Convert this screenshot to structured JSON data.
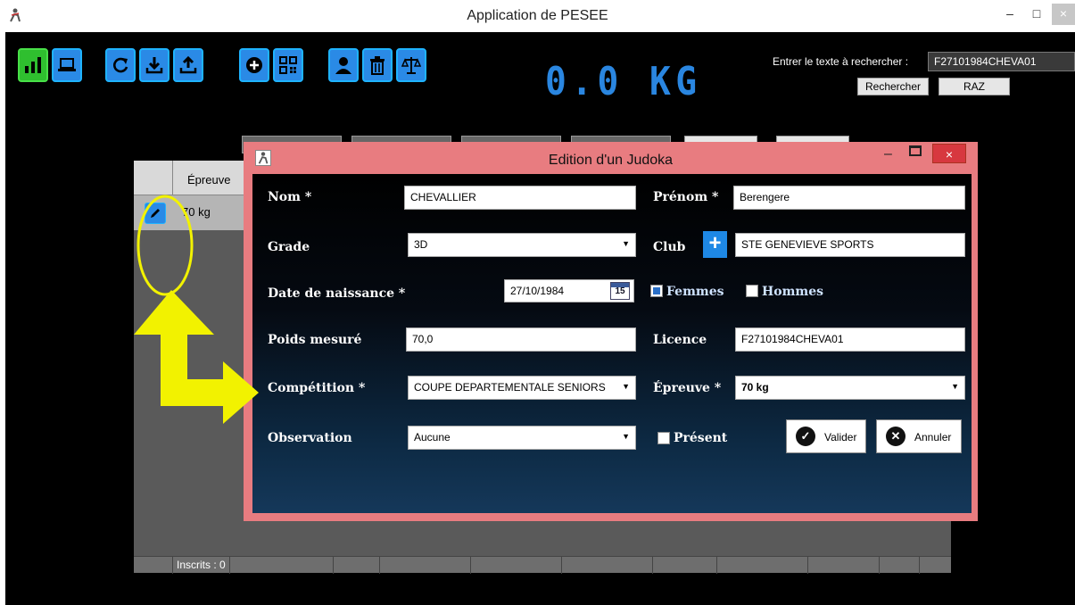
{
  "window": {
    "title": "Application de PESEE"
  },
  "scale": {
    "weight_display": "0.0 KG"
  },
  "search": {
    "label": "Entrer le texte à rechercher :",
    "value": "F27101984CHEVA01",
    "search_button": "Rechercher",
    "reset_button": "RAZ"
  },
  "toolbar": {
    "buttons": [
      "chart-icon",
      "laptop-icon",
      "refresh-icon",
      "download-icon",
      "upload-icon",
      "add-icon",
      "qrcode-icon",
      "user-icon",
      "trash-icon",
      "balance-icon"
    ]
  },
  "grid": {
    "column_header": "Épreuve",
    "row_value": "70 kg",
    "footer_count": "Inscrits : 0"
  },
  "dialog": {
    "title": "Edition d'un Judoka",
    "nom_label": "Nom *",
    "nom_value": "CHEVALLIER",
    "prenom_label": "Prénom *",
    "prenom_value": "Berengere",
    "grade_label": "Grade",
    "grade_value": "3D",
    "club_label": "Club",
    "club_value": "STE GENEVIEVE SPORTS",
    "naissance_label": "Date de naissance *",
    "naissance_value": "27/10/1984",
    "calendar_day": "15",
    "femmes_label": "Femmes",
    "femmes_checked": true,
    "hommes_label": "Hommes",
    "hommes_checked": false,
    "poids_label": "Poids mesuré",
    "poids_value": "70,0",
    "licence_label": "Licence",
    "licence_value": "F27101984CHEVA01",
    "competition_label": "Compétition *",
    "competition_value": "COUPE DEPARTEMENTALE SENIORS",
    "epreuve_label": "Épreuve *",
    "epreuve_value": "70 kg",
    "observation_label": "Observation",
    "observation_value": "Aucune",
    "present_label": "Présent",
    "present_checked": false,
    "valider_label": "Valider",
    "annuler_label": "Annuler"
  },
  "colors": {
    "accent_blue": "#2a8ae6",
    "dialog_frame": "#e87c80",
    "annotation_yellow": "#f2f200",
    "weight_blue": "#2a86e0"
  }
}
